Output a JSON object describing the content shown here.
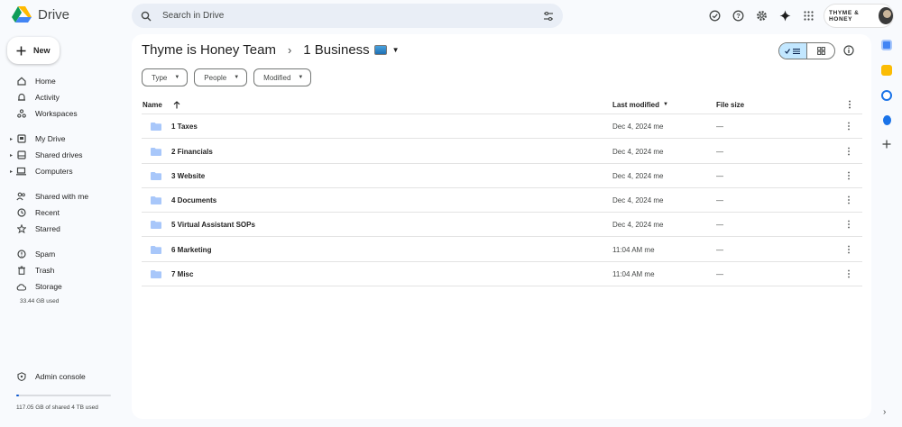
{
  "app": {
    "name": "Drive"
  },
  "search": {
    "placeholder": "Search in Drive"
  },
  "account": {
    "brand": "THYME & HONEY"
  },
  "sidebar": {
    "new_label": "New",
    "items": [
      {
        "label": "Home",
        "icon": "home-icon"
      },
      {
        "label": "Activity",
        "icon": "bell-icon"
      },
      {
        "label": "Workspaces",
        "icon": "workspaces-icon"
      },
      {
        "label": "My Drive",
        "icon": "my-drive-icon"
      },
      {
        "label": "Shared drives",
        "icon": "shared-drives-icon"
      },
      {
        "label": "Computers",
        "icon": "computer-icon"
      },
      {
        "label": "Shared with me",
        "icon": "people-icon"
      },
      {
        "label": "Recent",
        "icon": "clock-icon"
      },
      {
        "label": "Starred",
        "icon": "star-icon"
      },
      {
        "label": "Spam",
        "icon": "spam-icon"
      },
      {
        "label": "Trash",
        "icon": "trash-icon"
      },
      {
        "label": "Storage",
        "icon": "cloud-icon"
      },
      {
        "label": "Admin console",
        "icon": "admin-icon"
      }
    ],
    "storage_used": "33.44 GB used",
    "shared_storage": "117.05 GB of shared 4 TB used",
    "shared_storage_fraction": 0.029
  },
  "breadcrumb": {
    "parent": "Thyme is Honey Team",
    "current": "1 Business"
  },
  "filters": [
    "Type",
    "People",
    "Modified"
  ],
  "table": {
    "headers": {
      "name": "Name",
      "modified": "Last modified",
      "size": "File size"
    },
    "rows": [
      {
        "name": "1 Taxes",
        "modified": "Dec 4, 2024 me",
        "size": "—"
      },
      {
        "name": "2 Financials",
        "modified": "Dec 4, 2024 me",
        "size": "—"
      },
      {
        "name": "3 Website",
        "modified": "Dec 4, 2024 me",
        "size": "—"
      },
      {
        "name": "4 Documents",
        "modified": "Dec 4, 2024 me",
        "size": "—"
      },
      {
        "name": "5 Virtual Assistant SOPs",
        "modified": "Dec 4, 2024 me",
        "size": "—"
      },
      {
        "name": "6 Marketing",
        "modified": "11:04 AM me",
        "size": "—"
      },
      {
        "name": "7 Misc",
        "modified": "11:04 AM me",
        "size": "—"
      }
    ]
  },
  "colors": {
    "accent": "#0b57d0",
    "toggle_on": "#c2e7ff",
    "folder": "#a8c7fa",
    "bg": "#f8fafd"
  }
}
